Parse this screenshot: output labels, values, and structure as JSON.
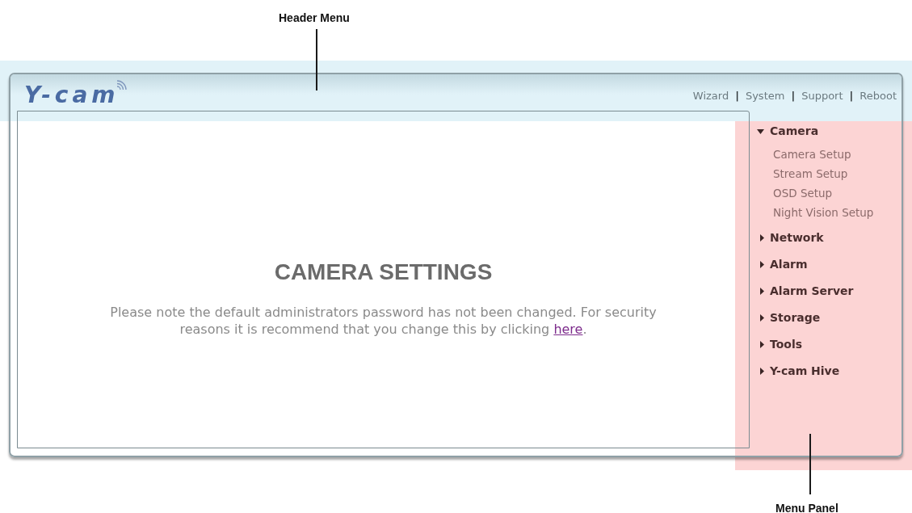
{
  "annotations": [
    {
      "label": "Header Menu"
    },
    {
      "label": "Menu Panel"
    }
  ],
  "header": {
    "logo": "Y-cam",
    "links": [
      {
        "label": "Wizard"
      },
      {
        "label": "System"
      },
      {
        "label": "Support"
      },
      {
        "label": "Reboot"
      }
    ],
    "separators": [
      "|",
      "|",
      "|"
    ]
  },
  "content": {
    "title": "CAMERA SETTINGS",
    "notice": {
      "text": "Please note the default administrators password has not been changed. For security reasons it is recommend that you change this by clicking",
      "link": "here",
      "end": "."
    }
  },
  "menu": [
    {
      "label": "Camera",
      "expanded": true,
      "children": [
        {
          "label": "Camera Setup"
        },
        {
          "label": "Stream Setup"
        },
        {
          "label": "OSD Setup"
        },
        {
          "label": "Night Vision Setup"
        }
      ]
    },
    {
      "label": "Network",
      "expanded": false
    },
    {
      "label": "Alarm",
      "expanded": false
    },
    {
      "label": "Alarm Server",
      "expanded": false
    },
    {
      "label": "Storage",
      "expanded": false
    },
    {
      "label": "Tools",
      "expanded": false
    },
    {
      "label": "Y-cam Hive",
      "expanded": false
    }
  ]
}
